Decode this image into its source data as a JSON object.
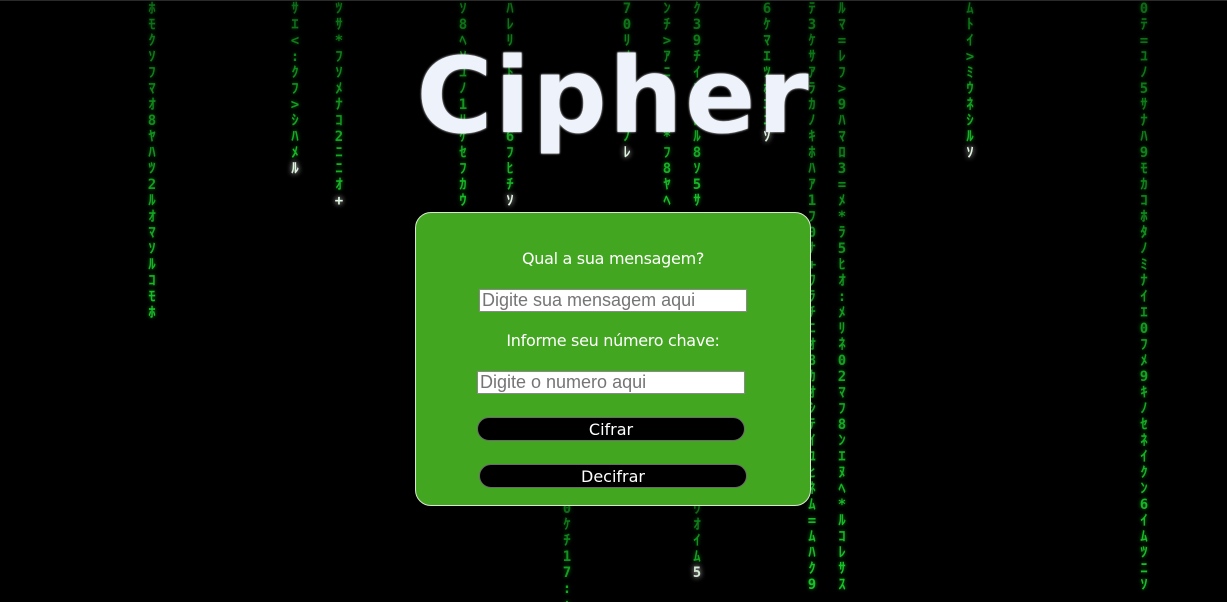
{
  "app": {
    "title": "Cipher"
  },
  "form": {
    "message_label": "Qual a sua mensagem?",
    "message_placeholder": "Digite sua mensagem aqui",
    "message_value": "",
    "key_label": "Informe seu número chave:",
    "key_placeholder": "Digite o numero aqui",
    "key_value": "",
    "encrypt_label": "Cifrar",
    "decrypt_label": "Decifrar"
  },
  "theme": {
    "background": "#000000",
    "panel_green": "#43a621",
    "rain_green": "#19c42a",
    "button_black": "#000000"
  },
  "background_effect": "matrix-code-rain"
}
